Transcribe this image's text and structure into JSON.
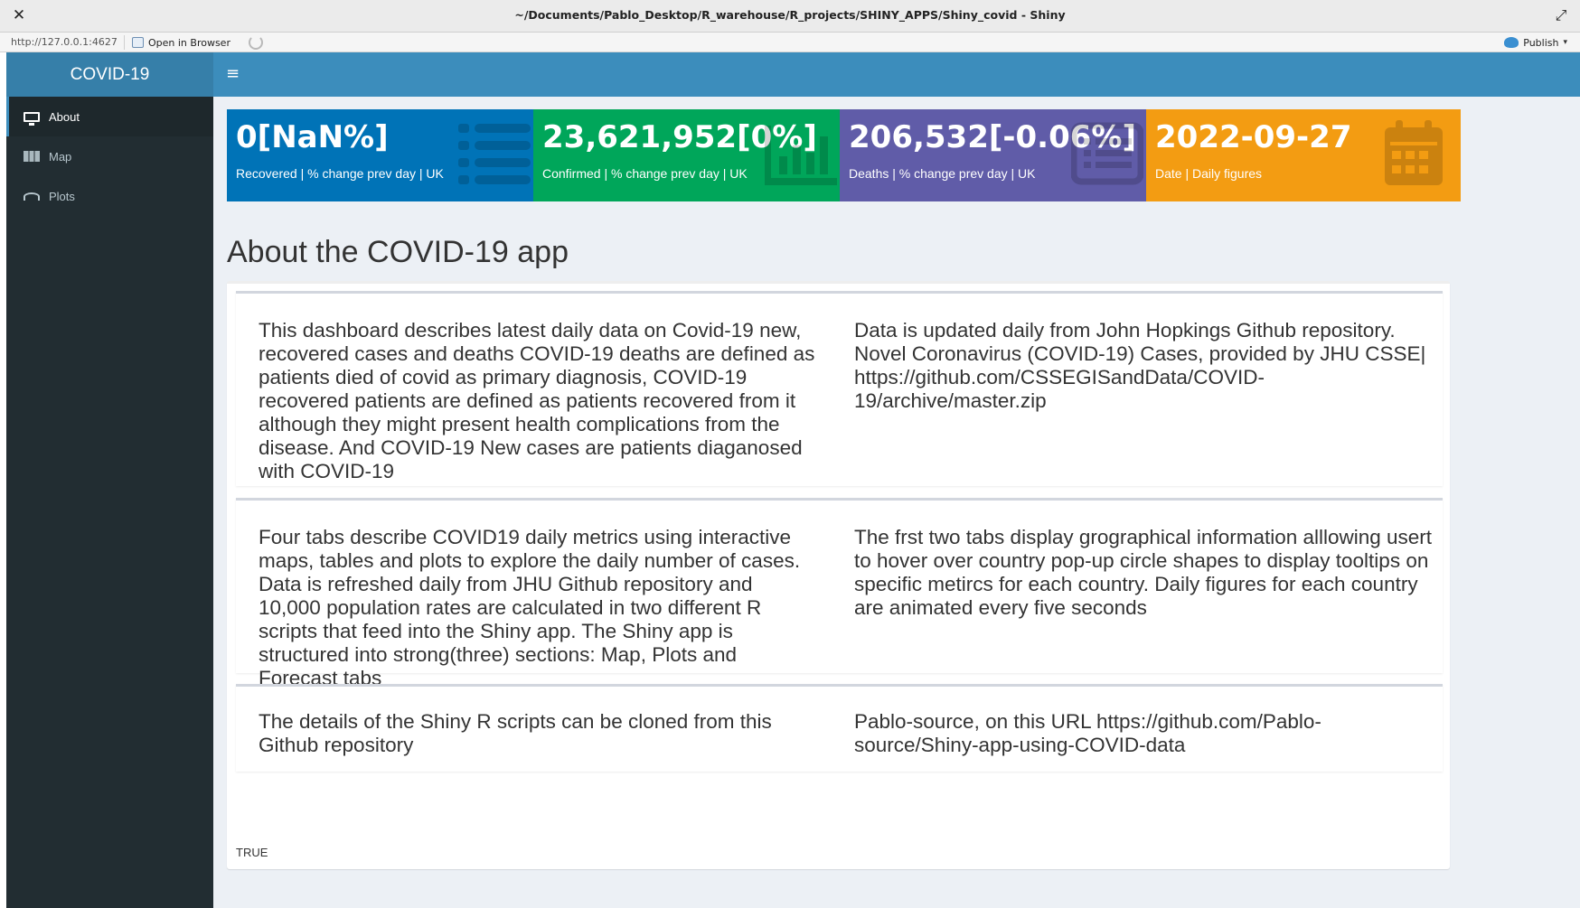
{
  "window": {
    "close_glyph": "✕",
    "title": "~/Documents/Pablo_Desktop/R_warehouse/R_projects/SHINY_APPS/Shiny_covid - Shiny",
    "maximize_glyph": "⤢"
  },
  "toolbar": {
    "url": "http://127.0.0.1:4627",
    "open_in_browser": "Open in Browser",
    "publish": "Publish"
  },
  "header": {
    "brand": "COVID-19",
    "menu_glyph": "≡"
  },
  "sidebar": {
    "items": [
      {
        "label": "About",
        "icon": "desktop-icon",
        "active": true
      },
      {
        "label": "Map",
        "icon": "map-icon",
        "active": false
      },
      {
        "label": "Plots",
        "icon": "wifi-icon",
        "active": false
      }
    ]
  },
  "value_boxes": [
    {
      "value": "0[NaN%]",
      "subtitle": "Recovered | % change prev day | UK",
      "color": "#0073b7",
      "icon": "list-icon"
    },
    {
      "value": "23,621,952[0%]",
      "subtitle": "Confirmed | % change prev day | UK",
      "color": "#00a65a",
      "icon": "bar-chart-icon"
    },
    {
      "value": "206,532[-0.06%]",
      "subtitle": "Deaths | % change prev day | UK",
      "color": "#605ca8",
      "icon": "list-alt-icon"
    },
    {
      "value": "2022-09-27",
      "subtitle": "Date | Daily figures",
      "color": "#f39c12",
      "icon": "calendar-icon"
    }
  ],
  "main": {
    "title": "About the COVID-19 app",
    "sections": [
      {
        "left": "This dashboard describes latest daily data on Covid-19 new, recovered cases and deaths COVID-19 deaths are defined as patients died of covid as primary diagnosis, COVID-19 recovered patients are defined as patients recovered from it although they might present health complications from the disease. And COVID-19 New cases are patients diaganosed with COVID-19",
        "right": "Data is updated daily from John Hopkings Github repository. Novel Coronavirus (COVID-19) Cases, provided by JHU CSSE| https://github.com/CSSEGISandData/COVID-19/archive/master.zip"
      },
      {
        "left": "Four tabs describe COVID19 daily metrics using interactive maps, tables and plots to explore the daily number of cases. Data is refreshed daily from JHU Github repository and 10,000 population rates are calculated in two different R scripts that feed into the Shiny app. The Shiny app is structured into strong(three) sections: Map, Plots and Forecast tabs",
        "right": "The frst two tabs display grographical information alllowing usert to hover over country pop-up circle shapes to display tooltips on specific metircs for each country. Daily figures for each country are animated every five seconds"
      },
      {
        "left": "The details of the Shiny R scripts can be cloned from this Github repository",
        "right": "Pablo-source, on this URL https://github.com/Pablo-source/Shiny-app-using-COVID-data"
      }
    ],
    "footer_text": "TRUE"
  }
}
